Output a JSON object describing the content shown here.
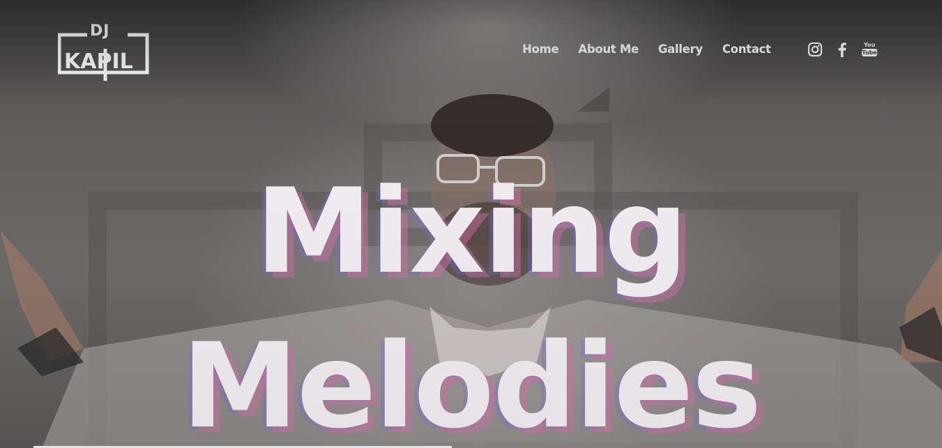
{
  "site": {
    "logo": {
      "top": "DJ",
      "name": "KAPIL"
    },
    "nav": [
      {
        "label": "Home"
      },
      {
        "label": "About Me"
      },
      {
        "label": "Gallery"
      },
      {
        "label": "Contact"
      }
    ],
    "social": {
      "instagram_icon": "instagram-icon",
      "facebook_icon": "facebook-icon",
      "youtube_icon": "youtube-icon",
      "youtube_top": "You",
      "youtube_bottom": "Tube"
    }
  },
  "hero": {
    "line1": "Mixing",
    "line2": "Melodies"
  },
  "colors": {
    "text": "#ffffff",
    "headline": "#f3eef2",
    "headline_shadow_pink": "#d670aa",
    "headline_shadow_violet": "#7c6ee6"
  }
}
